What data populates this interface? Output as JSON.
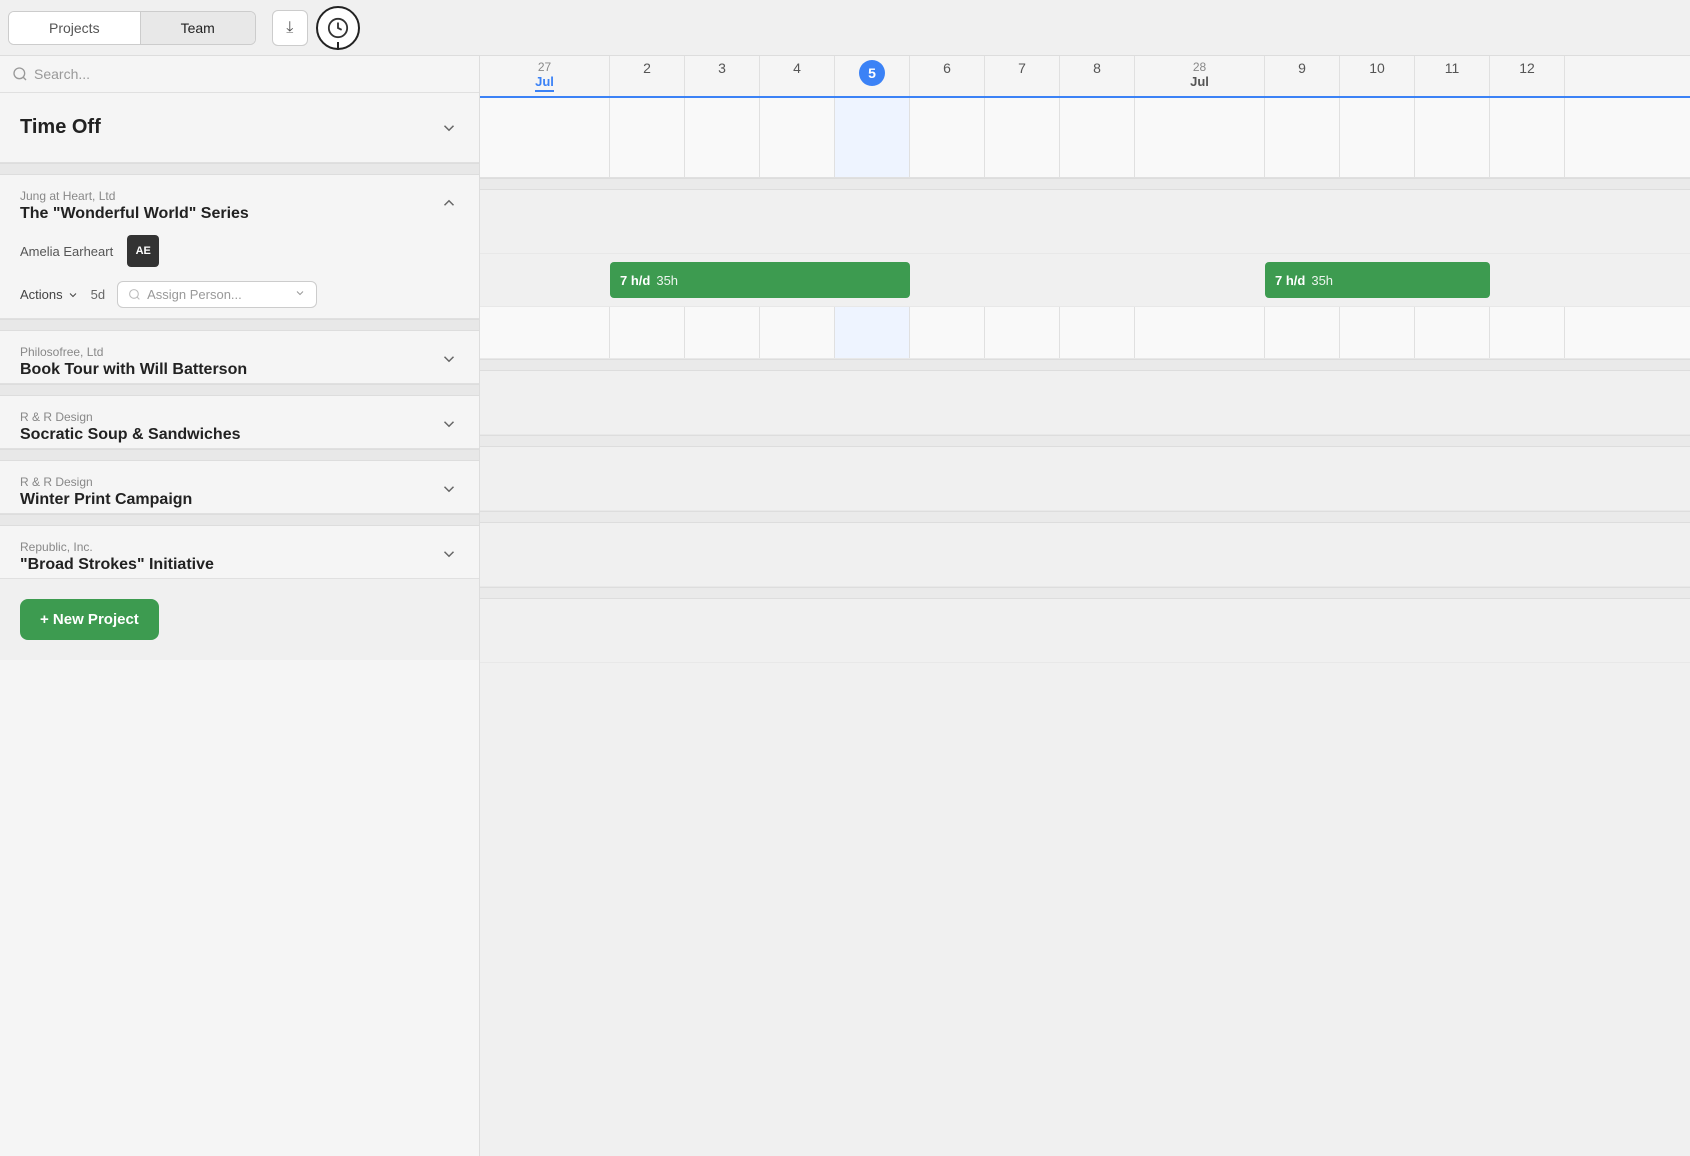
{
  "tabs": [
    {
      "id": "projects",
      "label": "Projects",
      "active": false
    },
    {
      "id": "team",
      "label": "Team",
      "active": true
    }
  ],
  "controls": {
    "collapse_icon": "⬇",
    "time_icon": "🕐"
  },
  "search": {
    "placeholder": "Search..."
  },
  "calendar": {
    "weeks": [
      {
        "num": "27",
        "month": "Jul",
        "highlight": false
      },
      {
        "num": "28",
        "month": "Jul",
        "highlight": false
      }
    ],
    "days": [
      2,
      3,
      4,
      5,
      6,
      7,
      8,
      9,
      10,
      11,
      12
    ],
    "today": 5
  },
  "timeoff": {
    "label": "Time Off"
  },
  "projects": [
    {
      "id": "wonderful-world",
      "client": "Jung at Heart, Ltd",
      "name": "The \"Wonderful World\" Series",
      "color": "green",
      "people": [
        {
          "name": "Amelia Earheart",
          "initials": "AE",
          "hours_per_day": "7 h/d",
          "total_hours": "35h"
        }
      ],
      "actions_label": "Actions",
      "duration": "5d",
      "assign_placeholder": "Assign Person..."
    },
    {
      "id": "book-tour",
      "client": "Philosofree, Ltd",
      "name": "Book Tour with Will Batterson",
      "color": "purple"
    },
    {
      "id": "socratic-soup",
      "client": "R & R Design",
      "name": "Socratic Soup & Sandwiches",
      "color": "blue"
    },
    {
      "id": "winter-print",
      "client": "R & R Design",
      "name": "Winter Print Campaign",
      "color": "pink"
    },
    {
      "id": "broad-strokes",
      "client": "Republic, Inc.",
      "name": "\"Broad Strokes\" Initiative",
      "color": "green"
    }
  ],
  "footer": {
    "new_project_label": "+ New Project"
  }
}
